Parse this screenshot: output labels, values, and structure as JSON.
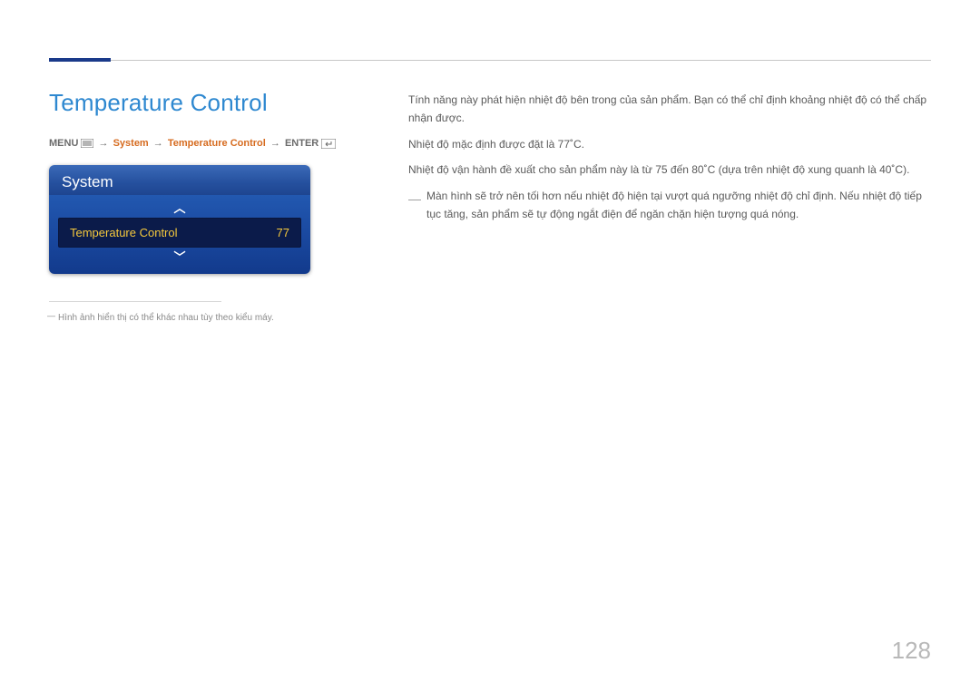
{
  "section_title": "Temperature Control",
  "breadcrumb": {
    "menu": "MENU",
    "system": "System",
    "temp": "Temperature Control",
    "enter": "ENTER"
  },
  "osd": {
    "header": "System",
    "row_label": "Temperature Control",
    "row_value": "77"
  },
  "left_footnote": "Hình ảnh hiển thị có thể khác nhau tùy theo kiểu máy.",
  "paragraphs": {
    "p1": "Tính năng này phát hiện nhiệt độ bên trong của sản phẩm. Bạn có thể chỉ định khoảng nhiệt độ có thể chấp nhận được.",
    "p2": "Nhiệt độ mặc định được đặt là 77˚C.",
    "p3": "Nhiệt độ vận hành đề xuất cho sản phẩm này là từ 75 đến 80˚C (dựa trên nhiệt độ xung quanh là 40˚C).",
    "note": "Màn hình sẽ trở nên tối hơn nếu nhiệt độ hiện tại vượt quá ngưỡng nhiệt độ chỉ định. Nếu nhiệt độ tiếp tục tăng, sản phẩm sẽ tự động ngắt điện để ngăn chặn hiện tượng quá nóng."
  },
  "page_number": "128"
}
